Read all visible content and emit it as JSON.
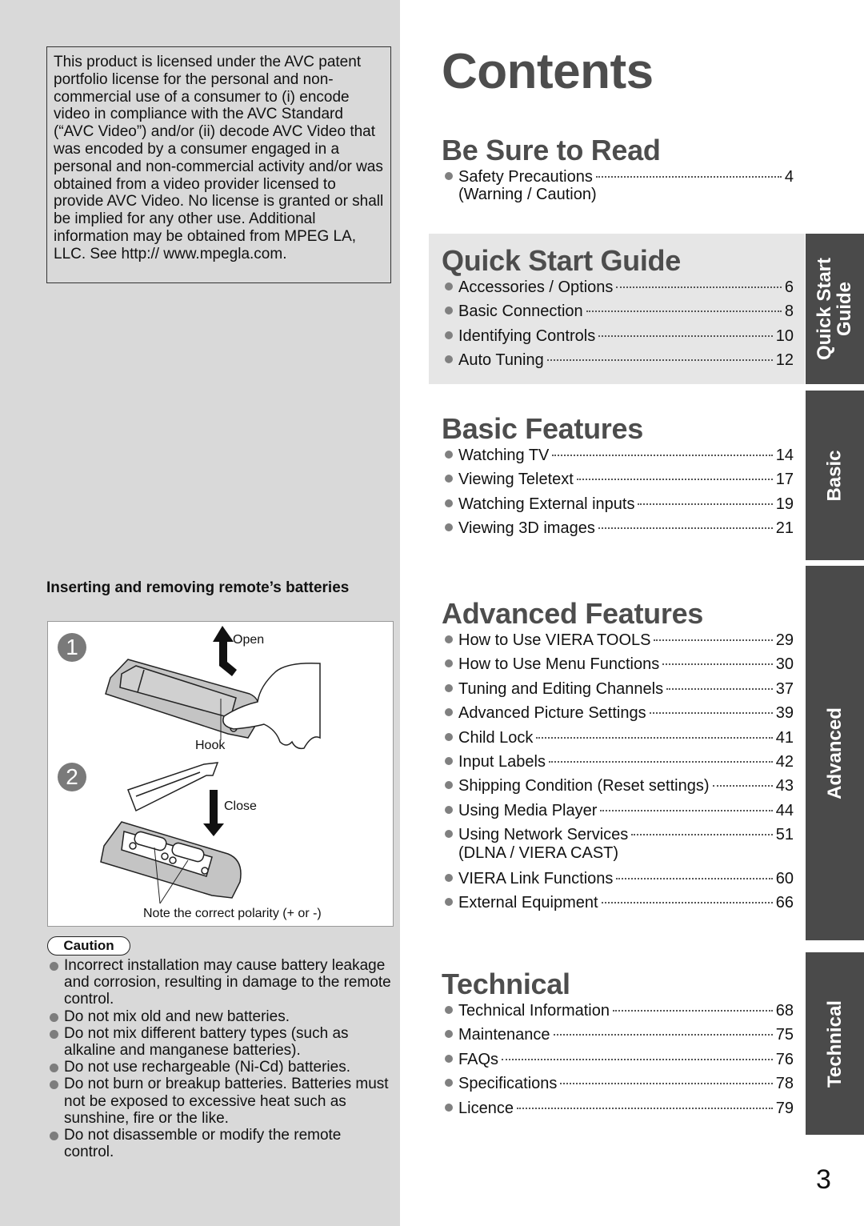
{
  "license_notice": "This product is licensed under the AVC patent portfolio license for the personal and non-commercial use of a consumer to (i) encode video in compliance with the AVC Standard (“AVC Video”) and/or (ii) decode AVC Video that was encoded by a consumer engaged in a personal and non-commercial activity and/or was obtained from a video provider licensed to provide AVC Video. No license is granted or shall be implied for any other use. Additional information may be obtained from MPEG LA, LLC. See http:// www.mpegla.com.",
  "batteries": {
    "title": "Inserting and removing remote’s batteries",
    "steps": [
      "1",
      "2"
    ],
    "labels": {
      "open": "Open",
      "hook": "Hook",
      "close": "Close",
      "polarity": "Note the correct polarity (+ or -)"
    },
    "caution_label": "Caution",
    "cautions": [
      "Incorrect installation may cause battery leakage and corrosion, resulting in damage to the remote control.",
      "Do not mix old and new batteries.",
      "Do not mix different battery types (such as alkaline and manganese batteries).",
      "Do not use rechargeable (Ni-Cd) batteries.",
      "Do not burn or breakup batteries. Batteries must not be exposed to excessive heat such as sunshine, fire or the like.",
      "Do not disassemble or modify the remote control."
    ]
  },
  "contents": {
    "title": "Contents",
    "sections": [
      {
        "heading": "Be Sure to Read",
        "items": [
          {
            "label": "Safety Precautions",
            "page": "4",
            "sub": "(Warning / Caution)"
          }
        ]
      },
      {
        "heading": "Quick Start Guide",
        "items": [
          {
            "label": "Accessories / Options",
            "page": "6"
          },
          {
            "label": "Basic Connection",
            "page": "8"
          },
          {
            "label": "Identifying Controls",
            "page": "10"
          },
          {
            "label": "Auto Tuning",
            "page": "12"
          }
        ]
      },
      {
        "heading": "Basic Features",
        "items": [
          {
            "label": "Watching TV",
            "page": "14"
          },
          {
            "label": "Viewing Teletext",
            "page": "17"
          },
          {
            "label": "Watching External inputs",
            "page": "19"
          },
          {
            "label": "Viewing 3D images",
            "page": "21"
          }
        ]
      },
      {
        "heading": "Advanced Features",
        "items": [
          {
            "label": "How to Use VIERA TOOLS",
            "page": "29"
          },
          {
            "label": "How to Use Menu Functions",
            "page": "30"
          },
          {
            "label": "Tuning and Editing Channels",
            "page": "37"
          },
          {
            "label": "Advanced Picture Settings",
            "page": "39"
          },
          {
            "label": "Child Lock",
            "page": "41"
          },
          {
            "label": "Input Labels",
            "page": "42"
          },
          {
            "label": "Shipping Condition (Reset settings)",
            "page": "43"
          },
          {
            "label": "Using Media Player",
            "page": "44"
          },
          {
            "label": "Using Network Services",
            "page": "51",
            "sub": "(DLNA / VIERA CAST)"
          },
          {
            "label": "VIERA Link Functions",
            "page": "60"
          },
          {
            "label": "External Equipment",
            "page": "66"
          }
        ]
      },
      {
        "heading": "Technical",
        "items": [
          {
            "label": "Technical Information",
            "page": "68"
          },
          {
            "label": "Maintenance",
            "page": "75"
          },
          {
            "label": "FAQs",
            "page": "76"
          },
          {
            "label": "Specifications",
            "page": "78"
          },
          {
            "label": "Licence",
            "page": "79"
          }
        ]
      }
    ]
  },
  "side_tabs": [
    {
      "line1": "Quick Start",
      "line2": "Guide"
    },
    {
      "line1": "Basic"
    },
    {
      "line1": "Advanced"
    },
    {
      "line1": "Technical"
    }
  ],
  "page_number": "3",
  "colors": {
    "left_panel": "#d9d9d9",
    "heading_gray": "#4d4d4d",
    "tab_dark": "#4a4a4a",
    "shaded_section": "#e6e6e6",
    "bullet_gray": "#808080"
  }
}
